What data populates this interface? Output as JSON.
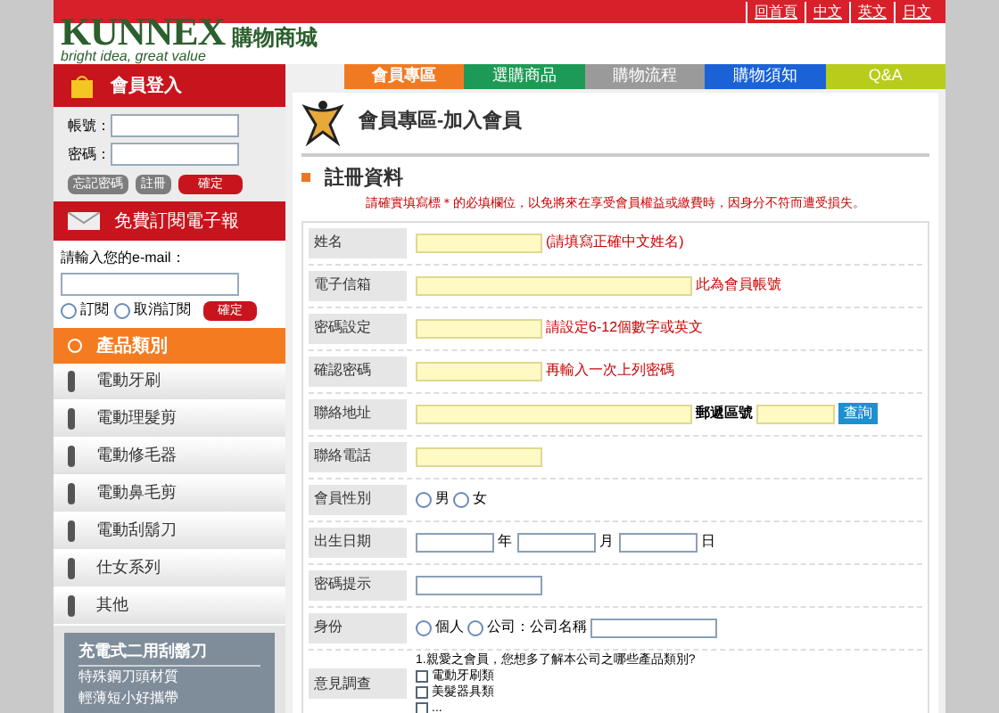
{
  "top_links": [
    "回首頁",
    "中文",
    "英文",
    "日文"
  ],
  "logo": {
    "brand": "KUNNEX",
    "slogan": "bright idea, great value",
    "store": "購物商城"
  },
  "nav_tabs": [
    {
      "label": "會員專區",
      "color": "#f07a22",
      "selected": true
    },
    {
      "label": "選購商品",
      "color": "#1d9a55",
      "selected": false
    },
    {
      "label": "購物流程",
      "color": "#9a9a9a",
      "selected": false
    },
    {
      "label": "購物須知",
      "color": "#1a62d6",
      "selected": false
    },
    {
      "label": "Q&A",
      "color": "#b8cc1c",
      "selected": false
    }
  ],
  "login": {
    "title": "會員登入",
    "fields": [
      {
        "label": "帳號："
      },
      {
        "label": "密碼："
      }
    ],
    "buttons": [
      {
        "label": "忘記密碼",
        "kind": "plain"
      },
      {
        "label": "註冊",
        "kind": "plain"
      },
      {
        "label": "確定",
        "kind": "primary"
      }
    ]
  },
  "newsletter": {
    "title": "免費訂閱電子報",
    "prompt": "請輸入您的e-mail：",
    "options": [
      {
        "label": "訂閱",
        "selected": false
      },
      {
        "label": "取消訂閱",
        "selected": false
      }
    ],
    "button": "確定"
  },
  "categories": {
    "title": "產品類別",
    "items": [
      "電動牙刷",
      "電動理髮剪",
      "電動修毛器",
      "電動鼻毛剪",
      "電動刮鬍刀",
      "仕女系列",
      "其他"
    ]
  },
  "promo": {
    "title": "充電式二用刮鬍刀",
    "lines": [
      "特殊鋼刀頭材質",
      "輕薄短小好攜帶"
    ]
  },
  "page_title": "會員專區-加入會員",
  "section_title": "註冊資料",
  "notice": "請確實填寫標＊的必填欄位，以免將來在享受會員權益或繳費時，因身分不符而遭受損失。",
  "form_rows": [
    {
      "label": "姓名",
      "kind": "text",
      "required": true,
      "hint": "(請填寫正確中文姓名)"
    },
    {
      "label": "電子信箱",
      "kind": "wide_text",
      "required": true,
      "hint": "此為會員帳號"
    },
    {
      "label": "密碼設定",
      "kind": "text",
      "required": true,
      "hint": "請設定6-12個數字或英文"
    },
    {
      "label": "確認密碼",
      "kind": "text",
      "required": true,
      "hint": "再輸入一次上列密碼"
    },
    {
      "label": "聯絡地址",
      "kind": "address",
      "zip_label": "郵遞區號",
      "button": "查詢"
    },
    {
      "label": "聯絡電話",
      "kind": "text",
      "required": true
    },
    {
      "label": "會員性別",
      "kind": "radio",
      "options": [
        {
          "label": "男",
          "selected": false
        },
        {
          "label": "女",
          "selected": false
        }
      ]
    },
    {
      "label": "出生日期",
      "kind": "date",
      "units": [
        "年",
        "月",
        "日"
      ]
    },
    {
      "label": "密碼提示",
      "kind": "text",
      "required": false
    },
    {
      "label": "身份",
      "kind": "identity",
      "options": [
        {
          "label": "個人",
          "selected": false
        },
        {
          "label": "公司：公司名稱",
          "selected": false
        }
      ]
    },
    {
      "label": "意見調查",
      "kind": "survey",
      "question": "1.親愛之會員，您想多了解本公司之哪些產品類別?",
      "choices": [
        {
          "label": "電動牙刷類",
          "checked": false
        },
        {
          "label": "美髮器具類",
          "checked": false
        },
        {
          "label": "...",
          "checked": false
        }
      ]
    }
  ]
}
